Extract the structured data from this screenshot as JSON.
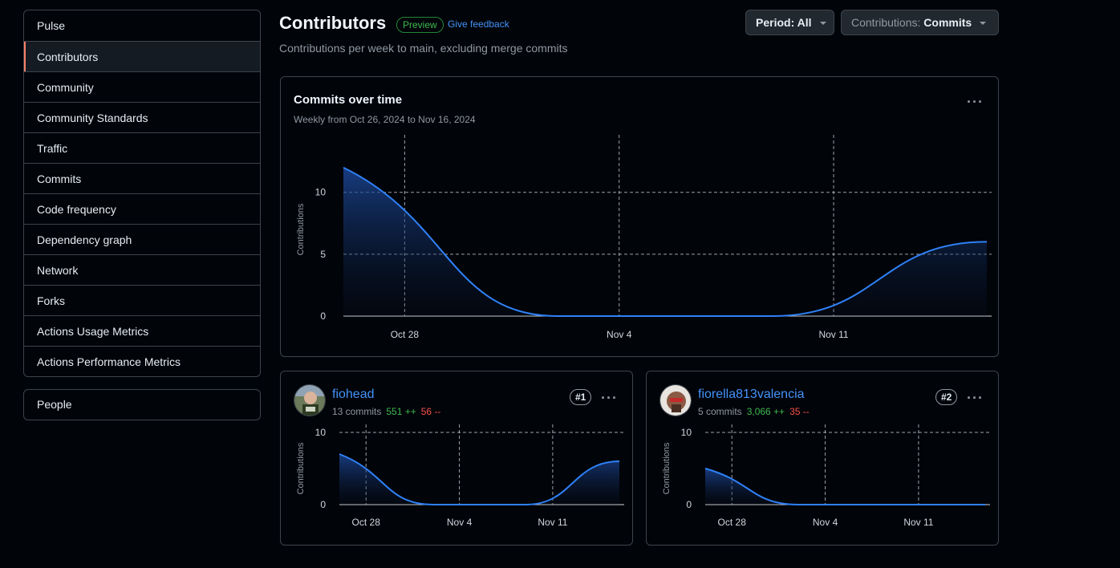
{
  "sidebar": {
    "items": [
      {
        "label": "Pulse"
      },
      {
        "label": "Contributors"
      },
      {
        "label": "Community"
      },
      {
        "label": "Community Standards"
      },
      {
        "label": "Traffic"
      },
      {
        "label": "Commits"
      },
      {
        "label": "Code frequency"
      },
      {
        "label": "Dependency graph"
      },
      {
        "label": "Network"
      },
      {
        "label": "Forks"
      },
      {
        "label": "Actions Usage Metrics"
      },
      {
        "label": "Actions Performance Metrics"
      }
    ],
    "selected_index": 1,
    "people_label": "People"
  },
  "header": {
    "title": "Contributors",
    "badge": "Preview",
    "feedback": "Give feedback",
    "subtitle": "Contributions per week to main, excluding merge commits",
    "period_prefix": "Period: ",
    "period_value": "All",
    "contrib_prefix": "Contributions: ",
    "contrib_value": "Commits"
  },
  "main_chart": {
    "title": "Commits over time",
    "subtitle": "Weekly from Oct 26, 2024 to Nov 16, 2024",
    "kebab": "···"
  },
  "contributors": [
    {
      "name": "fiohead",
      "commits": "13 commits",
      "additions": "551 ++",
      "deletions": "56 --",
      "rank": "#1",
      "kebab": "···"
    },
    {
      "name": "fiorella813valencia",
      "commits": "5 commits",
      "additions": "3,066 ++",
      "deletions": "35 --",
      "rank": "#2",
      "kebab": "···"
    }
  ],
  "colors": {
    "line": "#2f81f7",
    "grid": "#d0d7de",
    "accent": "#f78166"
  },
  "chart_data": [
    {
      "type": "area",
      "title": "Commits over time",
      "ylabel": "Contributions",
      "x": [
        "Oct 26",
        "Nov 2",
        "Nov 9",
        "Nov 16"
      ],
      "values": [
        12,
        0,
        0,
        6
      ],
      "xticks": [
        "Oct 28",
        "Nov 4",
        "Nov 11"
      ],
      "yticks": [
        0,
        5,
        10
      ],
      "ylim": [
        0,
        14
      ],
      "grid": true
    },
    {
      "type": "area",
      "ylabel": "Contributions",
      "x": [
        "Oct 26",
        "Nov 2",
        "Nov 9",
        "Nov 16"
      ],
      "values": [
        7,
        0,
        0,
        6
      ],
      "xticks": [
        "Oct 28",
        "Nov 4",
        "Nov 11"
      ],
      "yticks": [
        0,
        10
      ],
      "ylim": [
        0,
        10
      ],
      "grid": true
    },
    {
      "type": "area",
      "ylabel": "Contributions",
      "x": [
        "Oct 26",
        "Nov 2",
        "Nov 9",
        "Nov 16"
      ],
      "values": [
        5,
        0,
        0,
        0
      ],
      "xticks": [
        "Oct 28",
        "Nov 4",
        "Nov 11"
      ],
      "yticks": [
        0,
        10
      ],
      "ylim": [
        0,
        10
      ],
      "grid": true
    }
  ]
}
